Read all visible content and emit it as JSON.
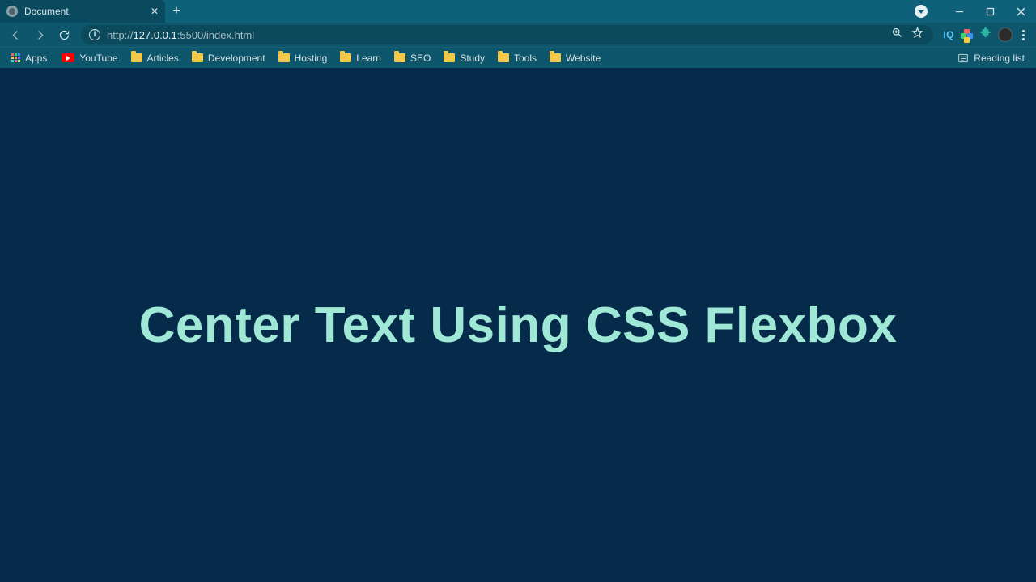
{
  "tab": {
    "title": "Document"
  },
  "url": {
    "scheme": "http://",
    "host": "127.0.0.1",
    "path": ":5500/index.html"
  },
  "bookmarks": {
    "apps": "Apps",
    "items": [
      {
        "label": "YouTube",
        "icon": "youtube"
      },
      {
        "label": "Articles",
        "icon": "folder"
      },
      {
        "label": "Development",
        "icon": "folder"
      },
      {
        "label": "Hosting",
        "icon": "folder"
      },
      {
        "label": "Learn",
        "icon": "folder"
      },
      {
        "label": "SEO",
        "icon": "folder"
      },
      {
        "label": "Study",
        "icon": "folder"
      },
      {
        "label": "Tools",
        "icon": "folder"
      },
      {
        "label": "Website",
        "icon": "folder"
      }
    ],
    "reading": "Reading list"
  },
  "toolbar_ext": {
    "iq": "IQ"
  },
  "page": {
    "heading": "Center Text Using CSS Flexbox"
  },
  "apps_colors": [
    "#ff5c5c",
    "#3bd16f",
    "#3b8bff",
    "#ffc93b",
    "#ff9a3b",
    "#7a5cff",
    "#3bd1c9",
    "#ff5cc0",
    "#c9ff5c"
  ]
}
